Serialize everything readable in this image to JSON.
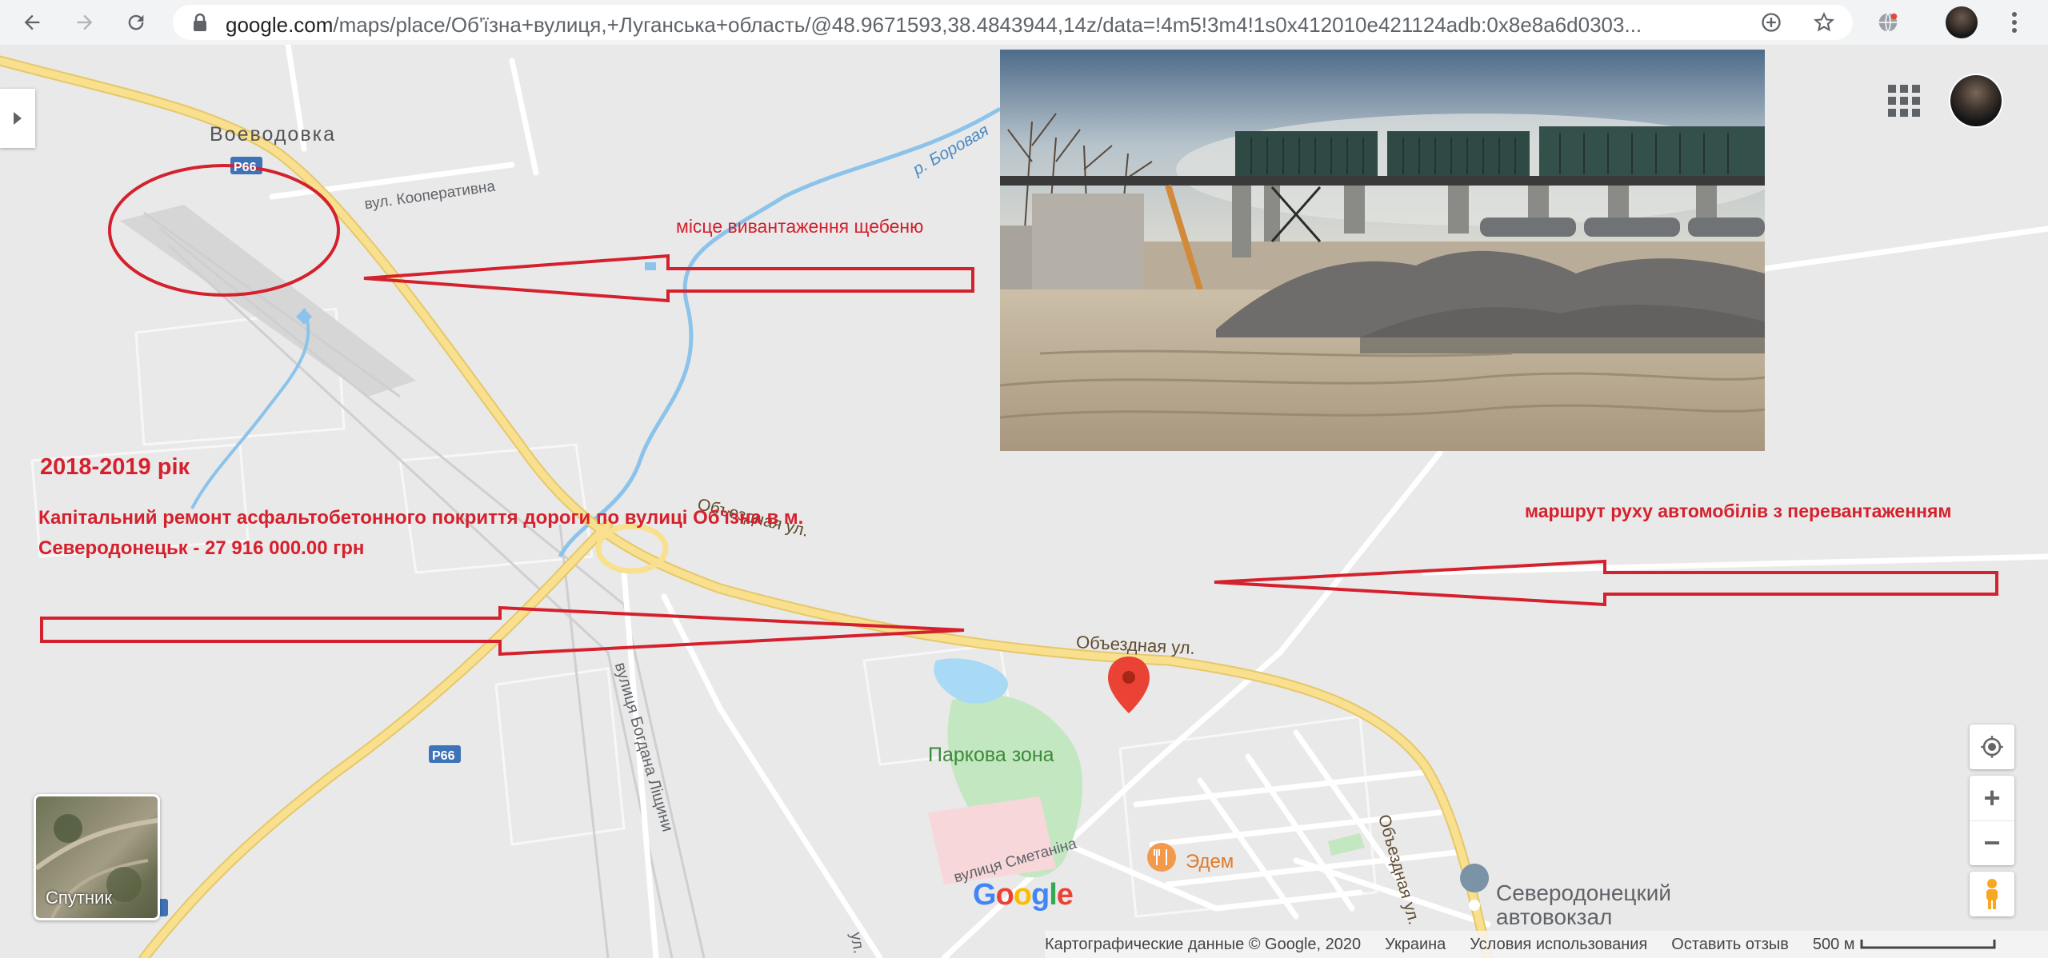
{
  "browser": {
    "url_host": "google.com",
    "url_path": "/maps/place/Об'їзна+вулиця,+Луганська+область/@48.9671593,38.4843944,14z/data=!4m5!3m4!1s0x412010e421124adb:0x8e8a6d0303..."
  },
  "map": {
    "labels": {
      "voevodovka": "Воеводовка",
      "kooperatyvna": "вул. Кооперативна",
      "borovaya": "р. Боровая",
      "r66": "Р66",
      "obyezdnaya_1": "Объездная ул.",
      "obyezdnaya_2": "Объездная ул.",
      "obyezdnaya_3": "Объездная ул.",
      "lishchyny": "вулиця Богдана Ліщини",
      "smetanina": "вулиця Сметаніна",
      "parkova": "Паркова зона",
      "edem": "Эдем",
      "avtovokzal_1": "Северодонецкий",
      "avtovokzal_2": "автовокзал",
      "u_road": "ул."
    },
    "satellite_label": "Спутник",
    "google_logo": "Google"
  },
  "annotations": {
    "unloading": "місце вивантаження щебеню",
    "year": "2018-2019 рік",
    "repair_line1": "Капітальний ремонт асфальтобетонного покриття дороги по вулиці Об'їзна в м.",
    "repair_line2": "Северодонецьк - 27 916 000.00 грн",
    "route": "маршрут руху автомобілів з перевантаженням"
  },
  "controls": {
    "zoom_in": "+",
    "zoom_out": "−"
  },
  "footer": {
    "copyright": "Картографические данные © Google, 2020",
    "country": "Украина",
    "terms": "Условия использования",
    "feedback": "Оставить отзыв",
    "scale": "500 м"
  },
  "colors": {
    "annotation_red": "#d4212d",
    "highway_yellow": "#f6d77a",
    "water": "#a8daf5",
    "park": "#c3e7c1"
  }
}
